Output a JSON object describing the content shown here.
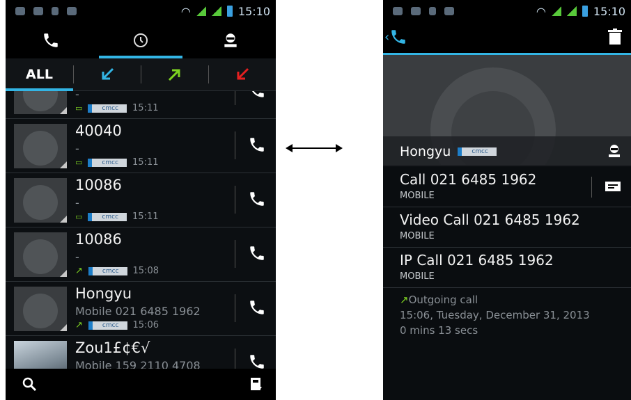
{
  "left": {
    "statusbar": {
      "time": "15:10"
    },
    "filter": {
      "all_label": "ALL"
    },
    "calls": [
      {
        "name": "",
        "sub": "-",
        "sim": "cmcc",
        "time": "15:11",
        "type": "incoming",
        "photo": false
      },
      {
        "name": "40040",
        "sub": "-",
        "sim": "cmcc",
        "time": "15:11",
        "type": "message",
        "photo": false
      },
      {
        "name": "10086",
        "sub": "-",
        "sim": "cmcc",
        "time": "15:11",
        "type": "message",
        "photo": false
      },
      {
        "name": "10086",
        "sub": "-",
        "sim": "cmcc",
        "time": "15:08",
        "type": "outgoing",
        "photo": false
      },
      {
        "name": "Hongyu",
        "sub": "Mobile 021 6485 1962",
        "sim": "cmcc",
        "time": "15:06",
        "type": "outgoing",
        "photo": false
      },
      {
        "name": "Zou1£¢€√",
        "sub": "Mobile 159 2110 4708",
        "sim": "",
        "time": "",
        "type": "outgoing",
        "photo": true
      }
    ]
  },
  "right": {
    "statusbar": {
      "time": "15:10"
    },
    "contact": {
      "name": "Hongyu",
      "sim": "cmcc"
    },
    "actions": [
      {
        "label": "Call 021 6485 1962",
        "type": "MOBILE"
      },
      {
        "label": "Video Call 021 6485 1962",
        "type": "MOBILE"
      },
      {
        "label": "IP Call 021 6485 1962",
        "type": "MOBILE"
      }
    ],
    "history": {
      "direction": "Outgoing call",
      "datetime": "15:06, Tuesday, December 31, 2013",
      "duration": "0 mins 13 secs"
    }
  },
  "colors": {
    "accent": "#33b5e5",
    "incoming": "#33b5e5",
    "outgoing": "#7ed321",
    "missed": "#e52020"
  }
}
